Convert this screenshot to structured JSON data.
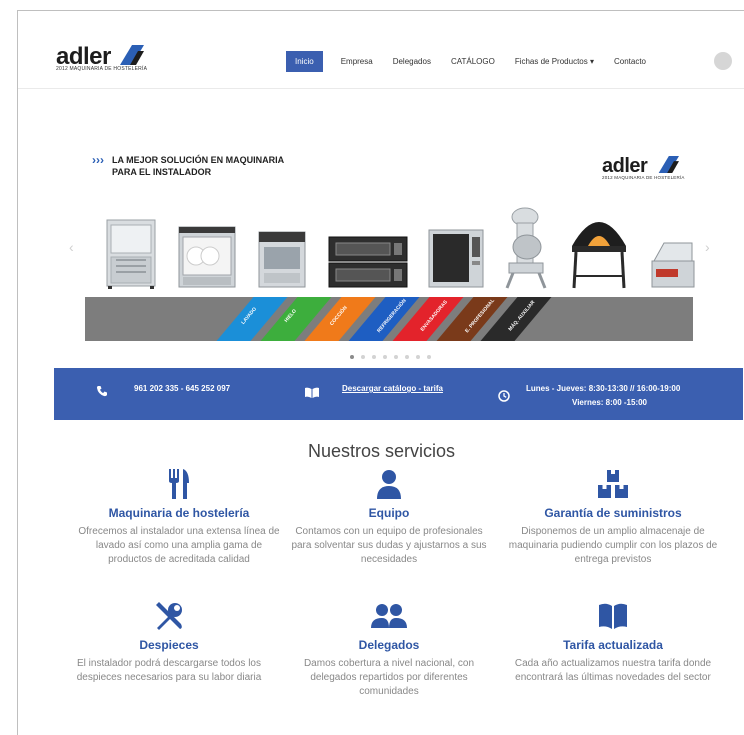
{
  "logo": {
    "word": "adler",
    "tagline": "2012 MAQUINARIA DE HOSTELERÍA"
  },
  "nav": {
    "items": [
      {
        "label": "Inicio",
        "active": true
      },
      {
        "label": "Empresa",
        "active": false
      },
      {
        "label": "Delegados",
        "active": false
      },
      {
        "label": "CATÁLOGO",
        "active": false
      },
      {
        "label": "Fichas de Productos ▾",
        "active": false
      },
      {
        "label": "Contacto",
        "active": false
      }
    ]
  },
  "slider": {
    "chevrons": "›››",
    "heading_line1": "LA MEJOR SOLUCIÓN EN MAQUINARIA",
    "heading_line2": "PARA EL INSTALADOR",
    "logo_word": "adler",
    "logo_tagline": "2012 MAQUINARIA DE HOSTELERÍA",
    "categories": [
      {
        "label": "LAVADO",
        "color": "#1b8fd8"
      },
      {
        "label": "HIELO",
        "color": "#3dae3d"
      },
      {
        "label": "COCCIÓN",
        "color": "#f07a1a"
      },
      {
        "label": "REFRIGERACIÓN",
        "color": "#1e5ec2"
      },
      {
        "label": "ENVASADORAS",
        "color": "#e3232b"
      },
      {
        "label": "E. PROFESIONAL",
        "color": "#7a3a1a"
      },
      {
        "label": "MÁQ. AUXILIAR",
        "color": "#2a2a2a"
      }
    ],
    "slide_count": 8,
    "active_slide": 1,
    "arrow_left": "‹",
    "arrow_right": "›"
  },
  "infobar": {
    "phone": "961 202 335 - 645 252 097",
    "catalog_link": "Descargar catálogo - tarifa",
    "hours_line1": "Lunes - Jueves: 8:30-13:30 // 16:00-19:00",
    "hours_line2": "Viernes: 8:00 -15:00"
  },
  "services": {
    "title": "Nuestros servicios",
    "items": [
      {
        "icon": "utensils-icon",
        "title": "Maquinaria de hostelería",
        "desc": "Ofrecemos al instalador una extensa línea de lavado así como una amplia gama de productos de acreditada calidad"
      },
      {
        "icon": "user-icon",
        "title": "Equipo",
        "desc": "Contamos con un equipo de profesionales para solventar sus dudas y ajustarnos a sus necesidades"
      },
      {
        "icon": "boxes-icon",
        "title": "Garantía de suministros",
        "desc": "Disponemos de un amplio almacenaje de maquinaria pudiendo cumplir con los plazos de entrega previstos"
      },
      {
        "icon": "tools-icon",
        "title": "Despieces",
        "desc": "El instalador podrá descargarse todos los despieces necesarios para su labor diaria"
      },
      {
        "icon": "users-icon",
        "title": "Delegados",
        "desc": "Damos cobertura a nivel nacional, con delegados repartidos por diferentes comunidades"
      },
      {
        "icon": "book-icon",
        "title": "Tarifa actualizada",
        "desc": "Cada año actualizamos nuestra tarifa donde encontrará las últimas novedades del sector"
      }
    ]
  },
  "colors": {
    "brand_blue": "#3b5fb0",
    "title_blue": "#2f56a4",
    "strip_gray": "#7d7d7d"
  }
}
